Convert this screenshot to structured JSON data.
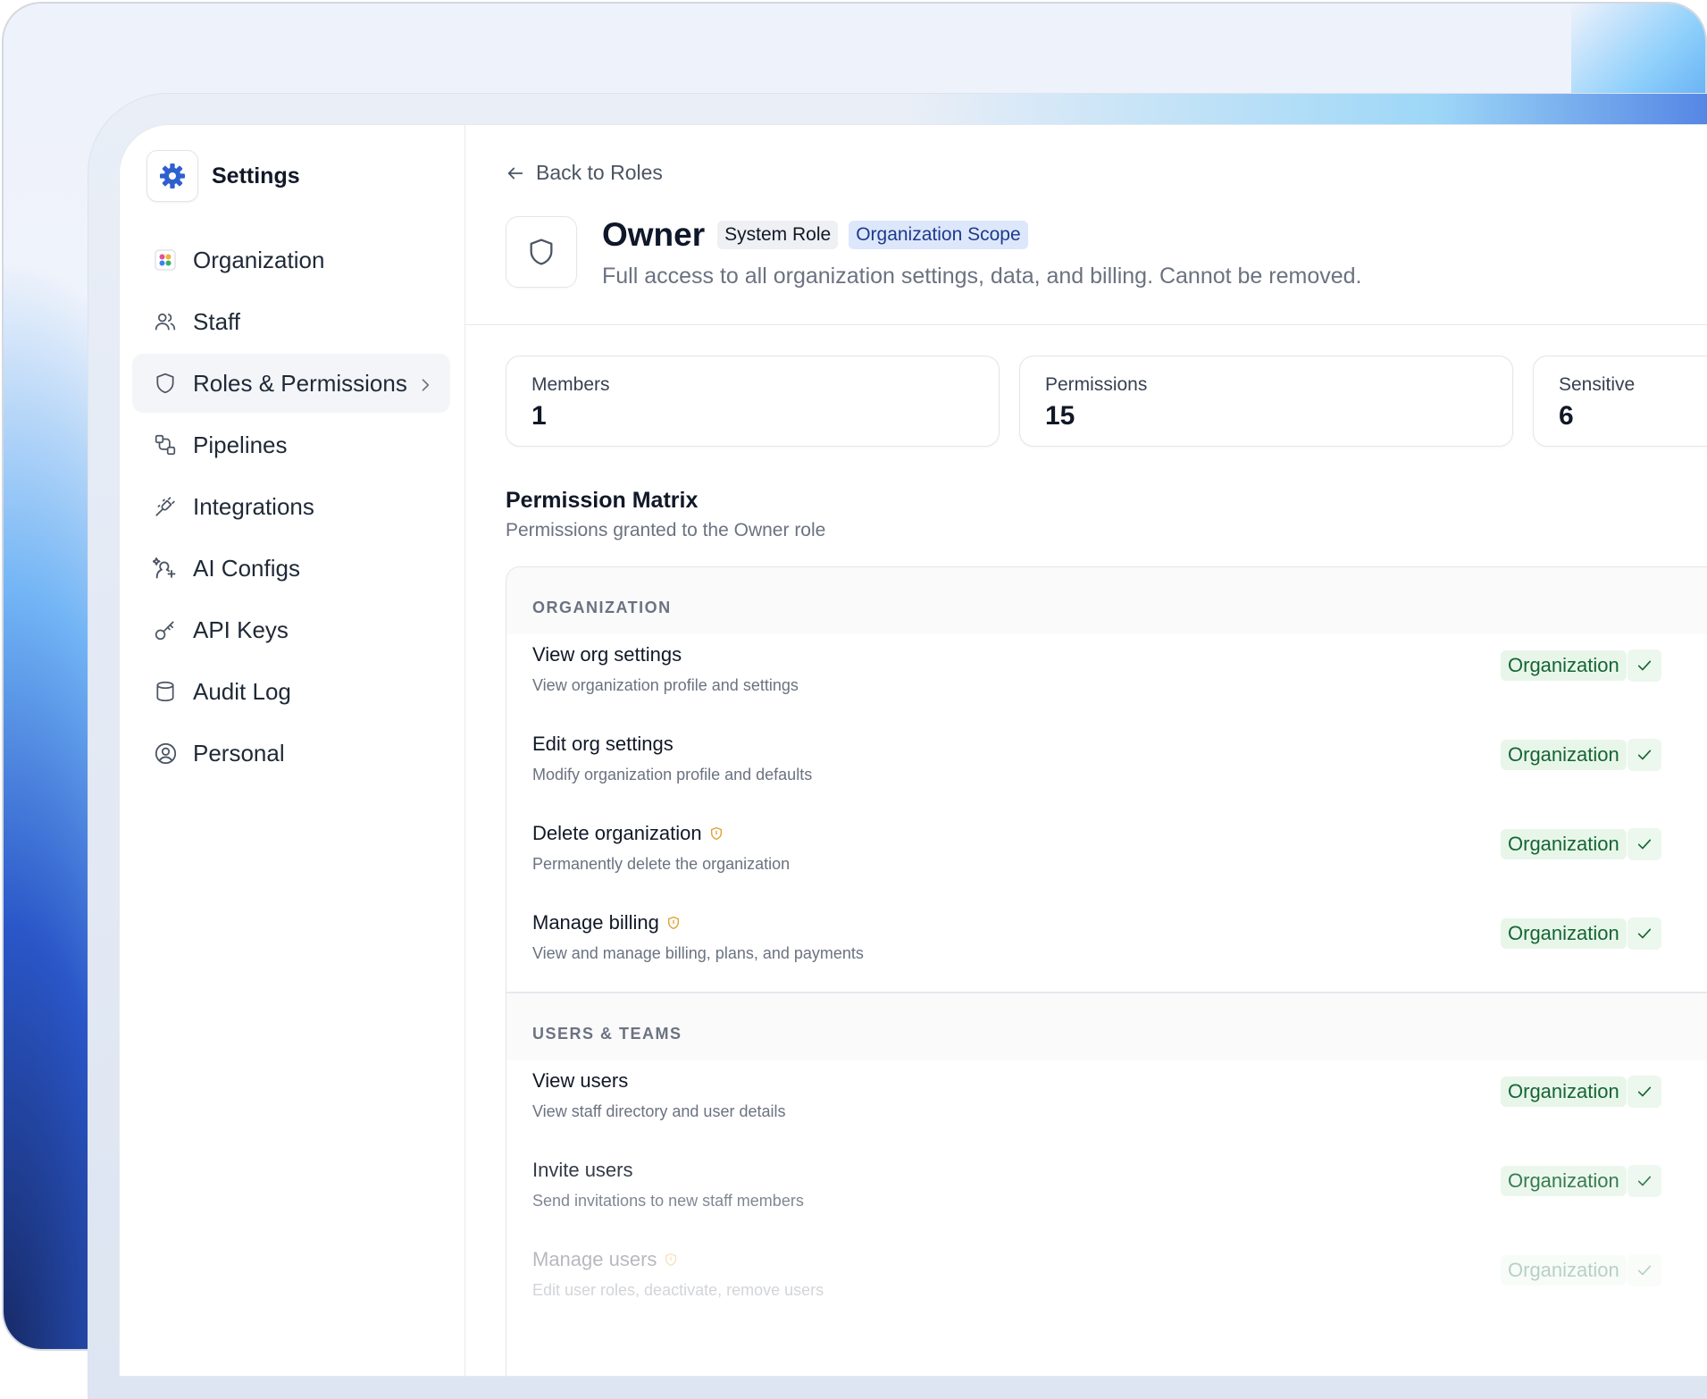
{
  "sidebar": {
    "title": "Settings",
    "items": [
      {
        "label": "Organization",
        "icon": "grid-colored-icon"
      },
      {
        "label": "Staff",
        "icon": "users-icon"
      },
      {
        "label": "Roles & Permissions",
        "icon": "shield-icon",
        "active": true
      },
      {
        "label": "Pipelines",
        "icon": "pipelines-icon"
      },
      {
        "label": "Integrations",
        "icon": "plug-icon"
      },
      {
        "label": "AI Configs",
        "icon": "ai-sparkle-icon"
      },
      {
        "label": "API Keys",
        "icon": "key-icon"
      },
      {
        "label": "Audit Log",
        "icon": "database-icon"
      },
      {
        "label": "Personal",
        "icon": "user-circle-icon"
      }
    ]
  },
  "header": {
    "back_label": "Back to Roles",
    "role_name": "Owner",
    "badge_system": "System Role",
    "badge_scope": "Organization Scope",
    "description": "Full access to all organization settings, data, and billing. Cannot be removed."
  },
  "stats": [
    {
      "label": "Members",
      "value": "1"
    },
    {
      "label": "Permissions",
      "value": "15"
    },
    {
      "label": "Sensitive",
      "value": "6"
    }
  ],
  "matrix": {
    "title": "Permission Matrix",
    "subtitle": "Permissions granted to the Owner role",
    "groups": [
      {
        "name": "ORGANIZATION",
        "permissions": [
          {
            "title": "View org settings",
            "desc": "View organization profile and settings",
            "scope": "Organization",
            "sensitive": false
          },
          {
            "title": "Edit org settings",
            "desc": "Modify organization profile and defaults",
            "scope": "Organization",
            "sensitive": false
          },
          {
            "title": "Delete organization",
            "desc": "Permanently delete the organization",
            "scope": "Organization",
            "sensitive": true
          },
          {
            "title": "Manage billing",
            "desc": "View and manage billing, plans, and payments",
            "scope": "Organization",
            "sensitive": true
          }
        ]
      },
      {
        "name": "USERS & TEAMS",
        "permissions": [
          {
            "title": "View users",
            "desc": "View staff directory and user details",
            "scope": "Organization",
            "sensitive": false
          },
          {
            "title": "Invite users",
            "desc": "Send invitations to new staff members",
            "scope": "Organization",
            "sensitive": false
          },
          {
            "title": "Manage users",
            "desc": "Edit user roles, deactivate, remove users",
            "scope": "Organization",
            "sensitive": true
          }
        ]
      }
    ]
  },
  "colors": {
    "accent": "#2f5fd0",
    "scope_bg": "#e8f6ea",
    "scope_text": "#166534",
    "sensitive": "#e0a030"
  }
}
